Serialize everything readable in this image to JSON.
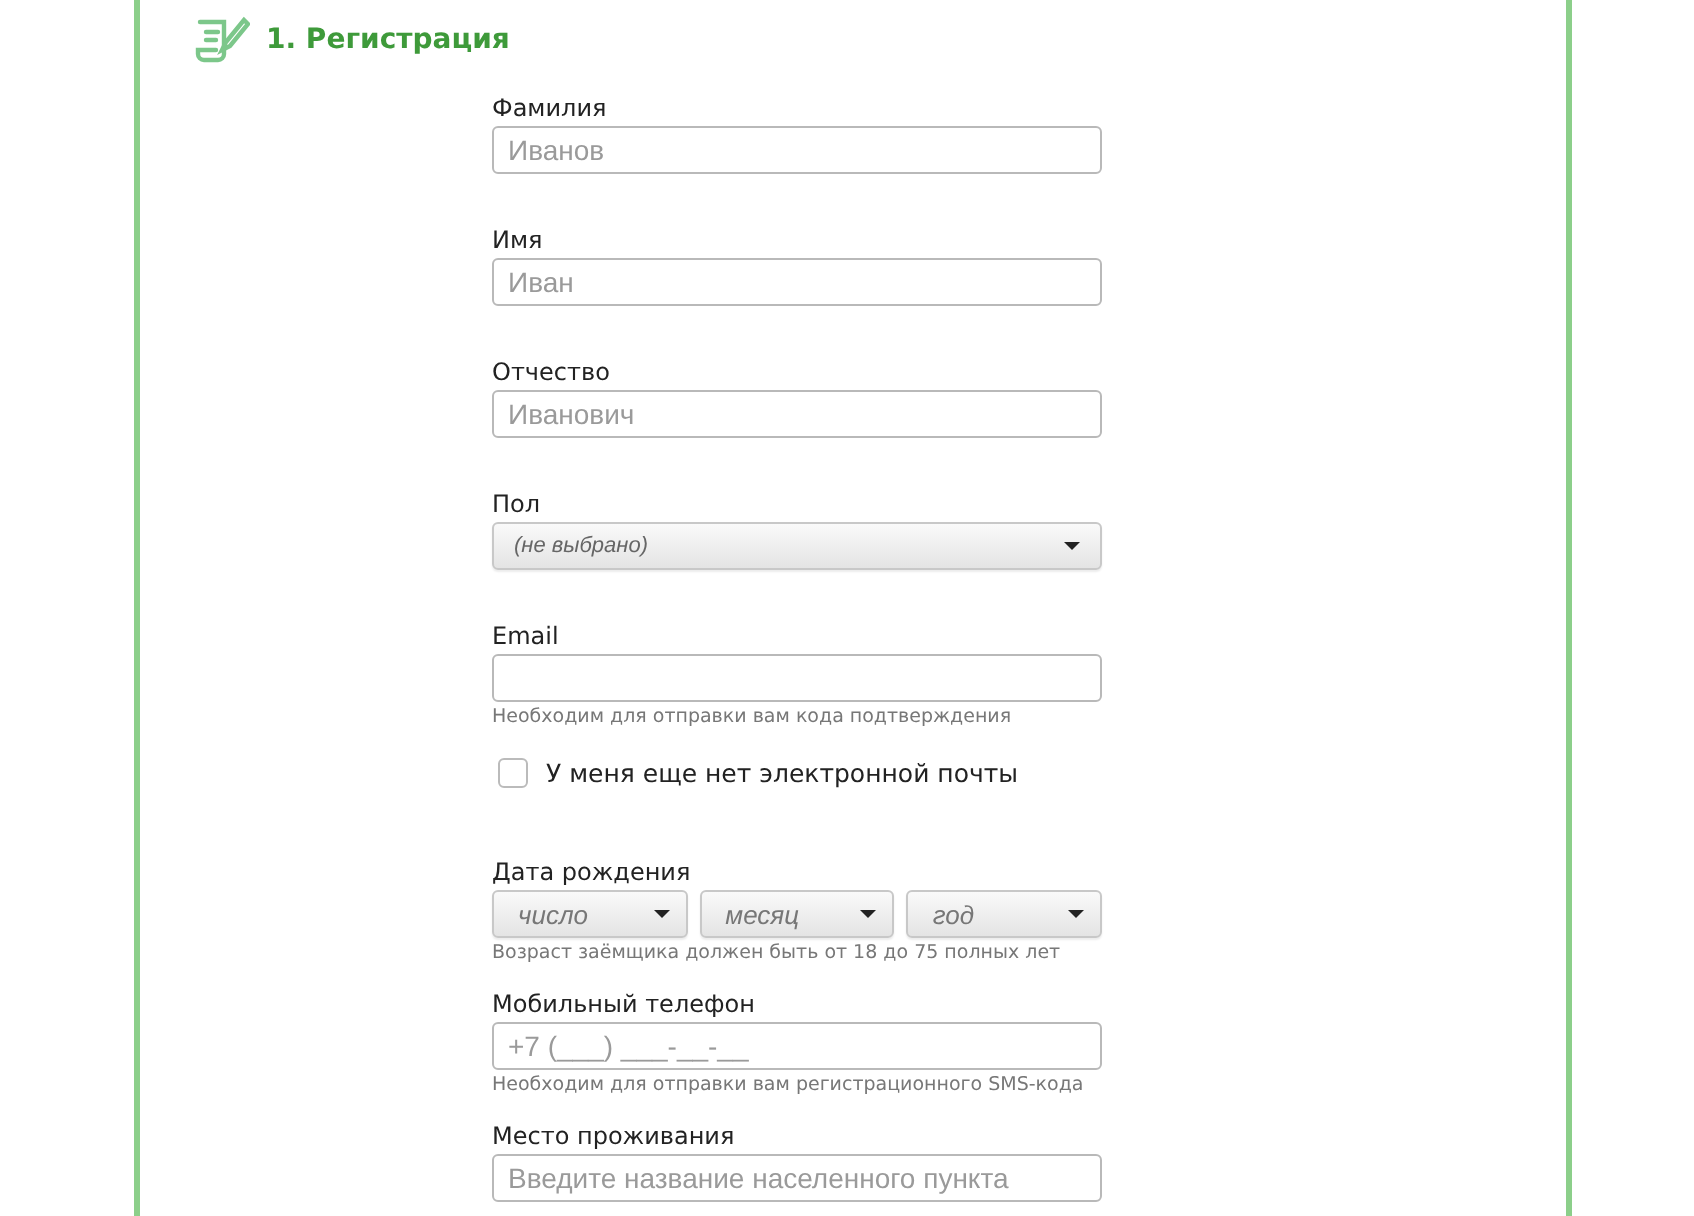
{
  "section": {
    "title": "1. Регистрация"
  },
  "fields": [
    {
      "kind": "text",
      "label": "Фамилия",
      "placeholder": "Иванов"
    },
    {
      "kind": "text",
      "label": "Имя",
      "placeholder": "Иван"
    },
    {
      "kind": "text",
      "label": "Отчество",
      "placeholder": "Иванович"
    },
    {
      "kind": "select",
      "label": "Пол",
      "value": "(не выбрано)"
    },
    {
      "kind": "text",
      "label": "Email",
      "hint": "Необходим для отправки вам кода подтверждения"
    },
    {
      "kind": "checkbox",
      "label": "У меня еще нет электронной почты",
      "checked": false
    },
    {
      "kind": "date",
      "label": "Дата рождения",
      "parts": [
        "число",
        "месяц",
        "год"
      ],
      "hint": "Возраст заёмщика должен быть от 18 до 75 полных лет"
    },
    {
      "kind": "text",
      "label": "Мобильный телефон",
      "placeholder": "+7 (___) ___-__-__",
      "hint": "Необходим для отправки вам регистрационного SMS-кода"
    },
    {
      "kind": "text",
      "label": "Место проживания",
      "placeholder": "Введите название населенного пункта"
    }
  ]
}
